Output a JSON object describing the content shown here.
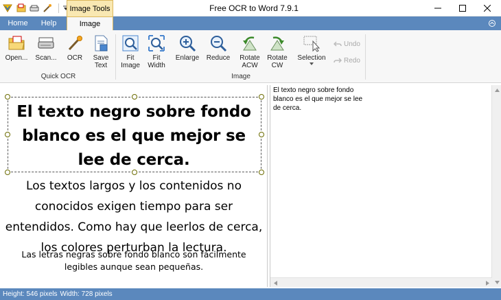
{
  "window": {
    "title": "Free OCR to Word 7.9.1",
    "context_tab": "Image Tools"
  },
  "tabs": [
    "Home",
    "Help",
    "Image"
  ],
  "ribbon": {
    "open": "Open...",
    "scan": "Scan...",
    "ocr": "OCR",
    "save_text": "Save Text",
    "group_quick_ocr": "Quick OCR",
    "fit_image": "Fit Image",
    "fit_width": "Fit Width",
    "enlarge": "Enlarge",
    "reduce": "Reduce",
    "rotate_acw": "Rotate ACW",
    "rotate_cw": "Rotate CW",
    "selection": "Selection",
    "group_image": "Image",
    "undo": "Undo",
    "redo": "Redo"
  },
  "image_text": {
    "heading": "El texto negro sobre fondo blanco es el que mejor se lee de cerca.",
    "body": "Los textos largos y los contenidos no conocidos exigen tiempo para ser entendidos. Como hay que leerlos de cerca, los colores perturban la lectura.",
    "small": "Las letras negras sobre fondo blanco son fácilmente legibles aunque sean pequeñas."
  },
  "ocr_result": "El texto negro sobre fondo\nblanco es el que mejor se lee\nde cerca.",
  "status": {
    "height": "Height: 546 pixels",
    "width": "Width: 728 pixels"
  },
  "icons": [
    "quick-access-app-icon",
    "quick-access-open-icon",
    "quick-access-scan-icon",
    "quick-access-ocr-icon",
    "quick-access-dropdown-icon",
    "minimize-icon",
    "maximize-icon",
    "close-icon",
    "collapse-ribbon-icon",
    "open-folder-icon",
    "scanner-icon",
    "ocr-wand-icon",
    "save-text-icon",
    "fit-image-icon",
    "fit-width-icon",
    "enlarge-icon",
    "reduce-icon",
    "rotate-acw-icon",
    "rotate-cw-icon",
    "selection-icon",
    "undo-icon",
    "redo-icon"
  ],
  "colors": {
    "ribbon_tabs": "#5b88bd",
    "context_tab": "#f9e8b2",
    "status_bar": "#5b88bd"
  }
}
